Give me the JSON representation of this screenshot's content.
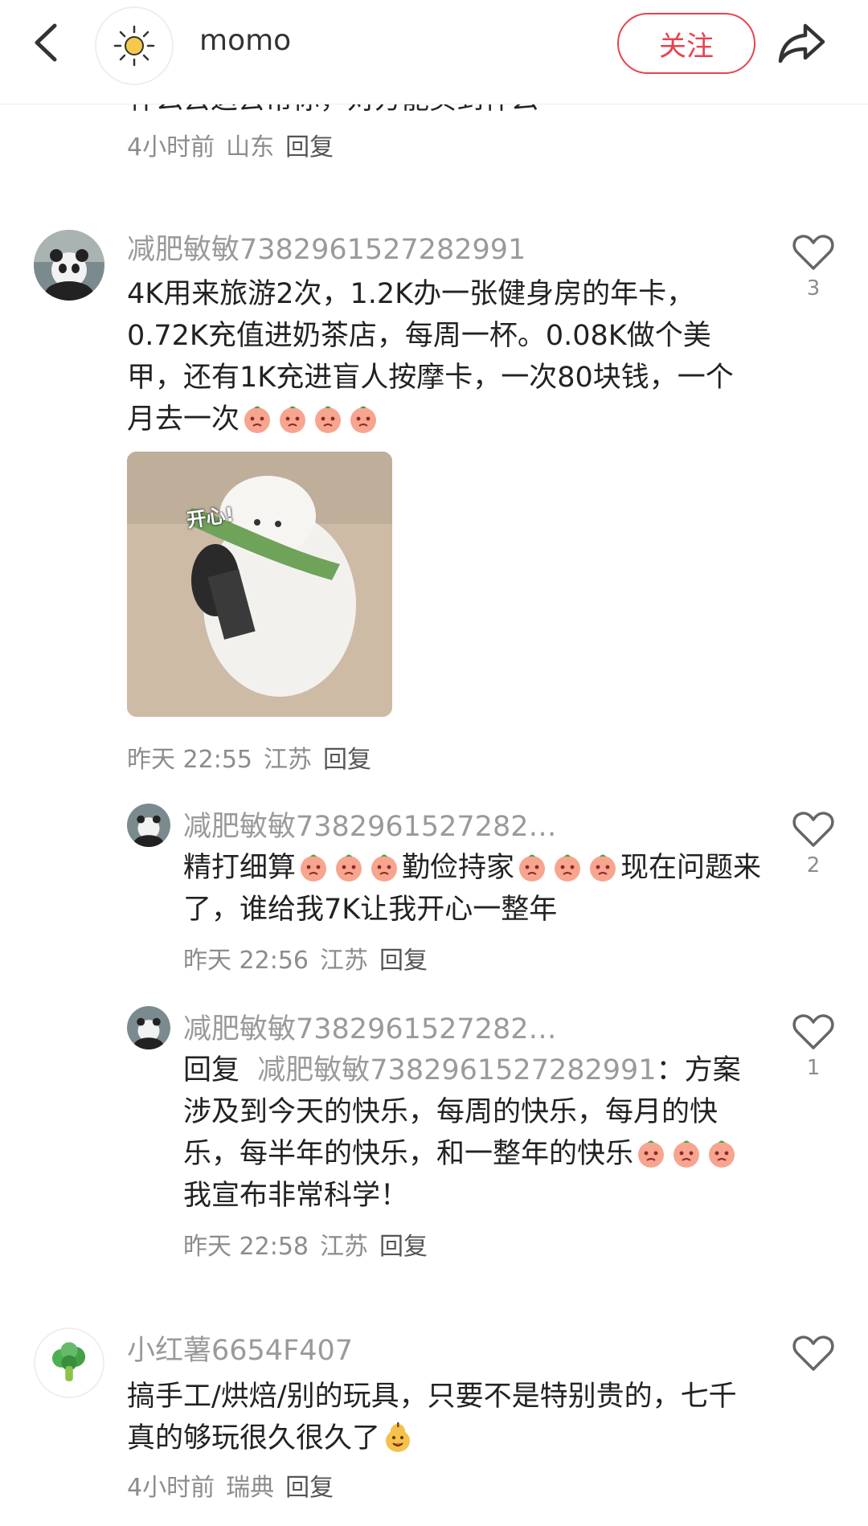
{
  "header": {
    "username": "momo",
    "follow_label": "关注"
  },
  "partial_comment": {
    "text": "什么去这去帮你，对方能买到什么",
    "meta_time": "4小时前",
    "meta_region": "山东",
    "reply_label": "回复"
  },
  "comments": [
    {
      "username": "减肥敏敏7382961527282991",
      "text": "4K用来旅游2次，1.2K办一张健身房的年卡，0.72K充值进奶茶店，每周一杯。0.08K做个美甲，还有1K充进盲人按摩卡，一次80块钱，一个月去一次",
      "image_caption": "开心!",
      "time": "昨天 22:55",
      "region": "江苏",
      "reply_label": "回复",
      "likes": "3"
    },
    {
      "username": "减肥敏敏7382961527282…",
      "text_part1": "精打细算",
      "text_part2": "勤俭持家",
      "text_part3": "现在问题来了，谁给我7K让我开心一整年",
      "time": "昨天 22:56",
      "region": "江苏",
      "reply_label": "回复",
      "likes": "2"
    },
    {
      "username": "减肥敏敏7382961527282…",
      "reply_prefix": "回复",
      "reply_target": "减肥敏敏7382961527282991",
      "text": "：方案涉及到今天的快乐，每周的快乐，每月的快乐，每半年的快乐，和一整年的快乐",
      "text_tail": "我宣布非常科学！",
      "time": "昨天 22:58",
      "region": "江苏",
      "reply_label": "回复",
      "likes": "1"
    },
    {
      "username": "小红薯6654F407",
      "text": "搞手工/烘焙/别的玩具，只要不是特别贵的，七千真的够玩很久很久了",
      "time": "4小时前",
      "region": "瑞典",
      "reply_label": "回复",
      "likes": ""
    }
  ],
  "colors": {
    "accent": "#e8424f",
    "meta": "#8c8c8c",
    "username": "#9a9a9a"
  },
  "icons": [
    "back-arrow-icon",
    "sun-icon",
    "share-icon",
    "heart-icon",
    "peach-emoji-icon",
    "pear-emoji-icon",
    "broccoli-icon"
  ]
}
